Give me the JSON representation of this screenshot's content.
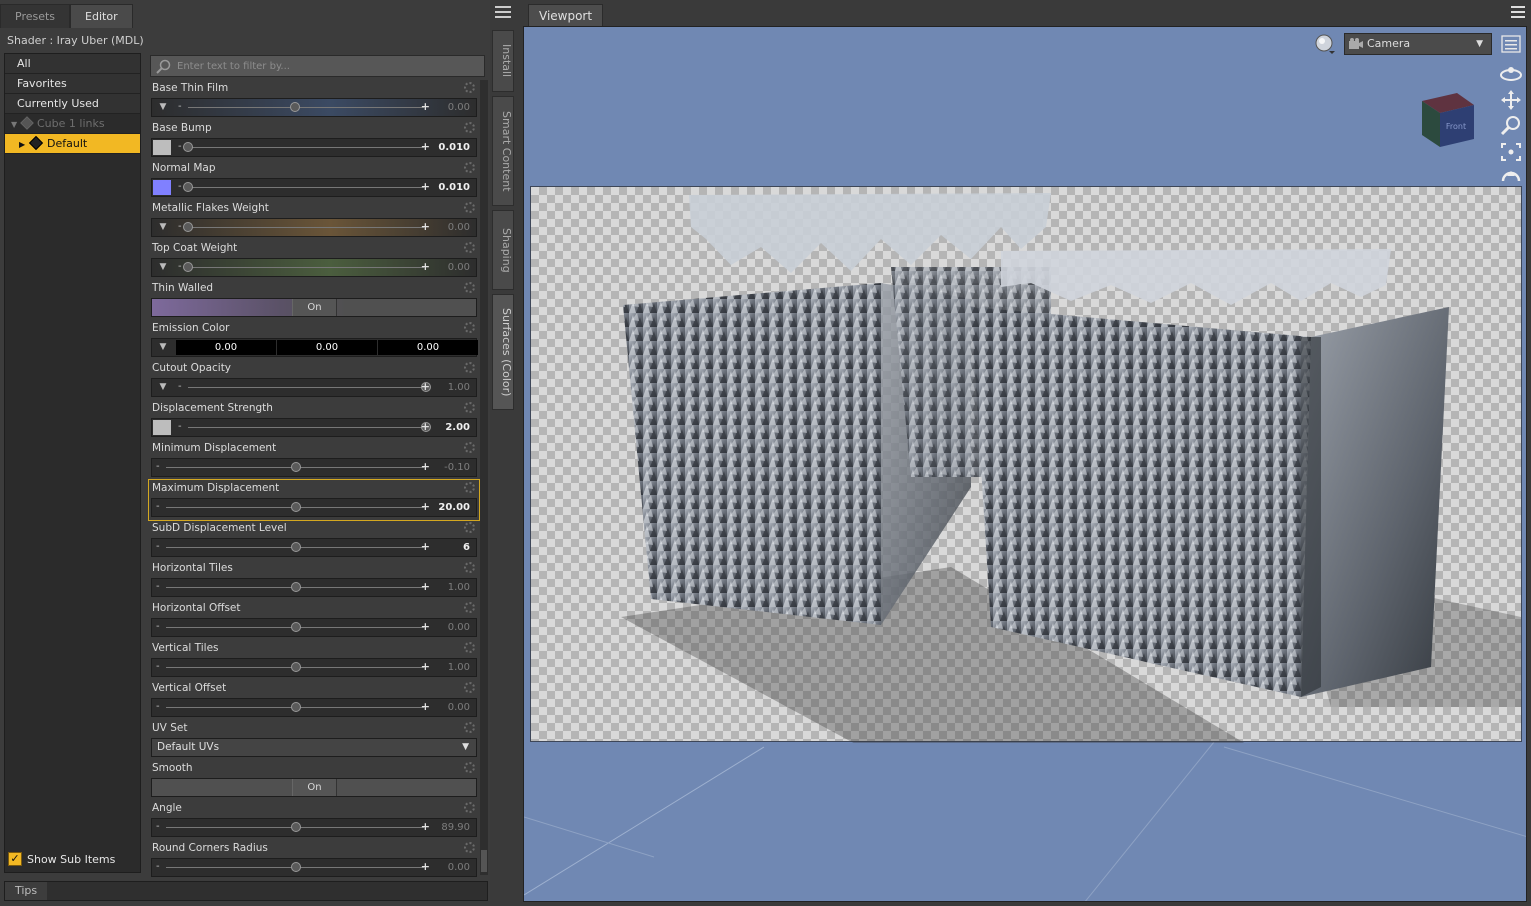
{
  "app": {
    "tabs": [
      {
        "label": "Presets",
        "active": false
      },
      {
        "label": "Editor",
        "active": true
      }
    ],
    "shader_label": "Shader :  Iray Uber (MDL)"
  },
  "tree": {
    "items": [
      {
        "label": "All",
        "state": "normal"
      },
      {
        "label": "Favorites",
        "state": "normal"
      },
      {
        "label": "Currently Used",
        "state": "normal"
      }
    ],
    "object": "Cube 1 links",
    "selected": "Default",
    "show_sub_items_label": "Show Sub Items",
    "show_sub_items_checked": true
  },
  "filter": {
    "placeholder": "Enter text to filter by..."
  },
  "properties": [
    {
      "label": "Base Thin Film",
      "kind": "slider",
      "lead": "drop",
      "pos": 0.45,
      "value": "0.00",
      "bright": false,
      "tint": "#3b4a63"
    },
    {
      "label": "Base Bump",
      "kind": "slider",
      "lead": "map",
      "map_color": "#bdbdbd",
      "pos": 0.0,
      "value": "0.010",
      "bright": true
    },
    {
      "label": "Normal Map",
      "kind": "slider",
      "lead": "map",
      "map_color": "#8080ff",
      "pos": 0.0,
      "value": "0.010",
      "bright": true
    },
    {
      "label": "Metallic Flakes Weight",
      "kind": "slider",
      "lead": "drop",
      "pos": 0.0,
      "value": "0.00",
      "bright": false,
      "tint": "#6a5538"
    },
    {
      "label": "Top Coat Weight",
      "kind": "slider",
      "lead": "drop",
      "pos": 0.0,
      "value": "0.00",
      "bright": false,
      "tint": "#4b5e3e"
    },
    {
      "label": "Thin Walled",
      "kind": "toggle",
      "value": "On"
    },
    {
      "label": "Emission Color",
      "kind": "rgb",
      "values": [
        "0.00",
        "0.00",
        "0.00"
      ]
    },
    {
      "label": "Cutout Opacity",
      "kind": "slider",
      "lead": "drop",
      "pos": 1.0,
      "value": "1.00",
      "bright": false
    },
    {
      "label": "Displacement Strength",
      "kind": "slider",
      "lead": "map",
      "map_color": "#bdbdbd",
      "pos": 1.0,
      "value": "2.00",
      "bright": true
    },
    {
      "label": "Minimum Displacement",
      "kind": "slider",
      "lead": "none",
      "pos": 0.5,
      "value": "-0.10",
      "bright": false
    },
    {
      "label": "Maximum Displacement",
      "kind": "slider",
      "lead": "none",
      "pos": 0.5,
      "value": "20.00",
      "bright": true,
      "highlight": true
    },
    {
      "label": "SubD Displacement Level",
      "kind": "slider",
      "lead": "none",
      "pos": 0.5,
      "value": "6",
      "bright": true
    },
    {
      "label": "Horizontal Tiles",
      "kind": "slider",
      "lead": "none",
      "pos": 0.5,
      "value": "1.00",
      "bright": false
    },
    {
      "label": "Horizontal Offset",
      "kind": "slider",
      "lead": "none",
      "pos": 0.5,
      "value": "0.00",
      "bright": false
    },
    {
      "label": "Vertical Tiles",
      "kind": "slider",
      "lead": "none",
      "pos": 0.5,
      "value": "1.00",
      "bright": false
    },
    {
      "label": "Vertical Offset",
      "kind": "slider",
      "lead": "none",
      "pos": 0.5,
      "value": "0.00",
      "bright": false
    },
    {
      "label": "UV Set",
      "kind": "select",
      "value": "Default UVs"
    },
    {
      "label": "Smooth",
      "kind": "toggle",
      "value": "On"
    },
    {
      "label": "Angle",
      "kind": "slider",
      "lead": "none",
      "pos": 0.5,
      "value": "89.90",
      "bright": false
    },
    {
      "label": "Round Corners Radius",
      "kind": "slider",
      "lead": "none",
      "pos": 0.5,
      "value": "0.00",
      "bright": false
    }
  ],
  "side_tabs": [
    {
      "label": "Install",
      "active": false
    },
    {
      "label": "Smart Content",
      "active": false
    },
    {
      "label": "Shaping",
      "active": false
    },
    {
      "label": "Surfaces (Color)",
      "active": true
    }
  ],
  "tips_label": "Tips",
  "viewport": {
    "tab_label": "Viewport",
    "camera_label": "Camera",
    "nav_cube_label": "Front",
    "background_color": "#7088b3",
    "accent_color": "#f2b823"
  }
}
